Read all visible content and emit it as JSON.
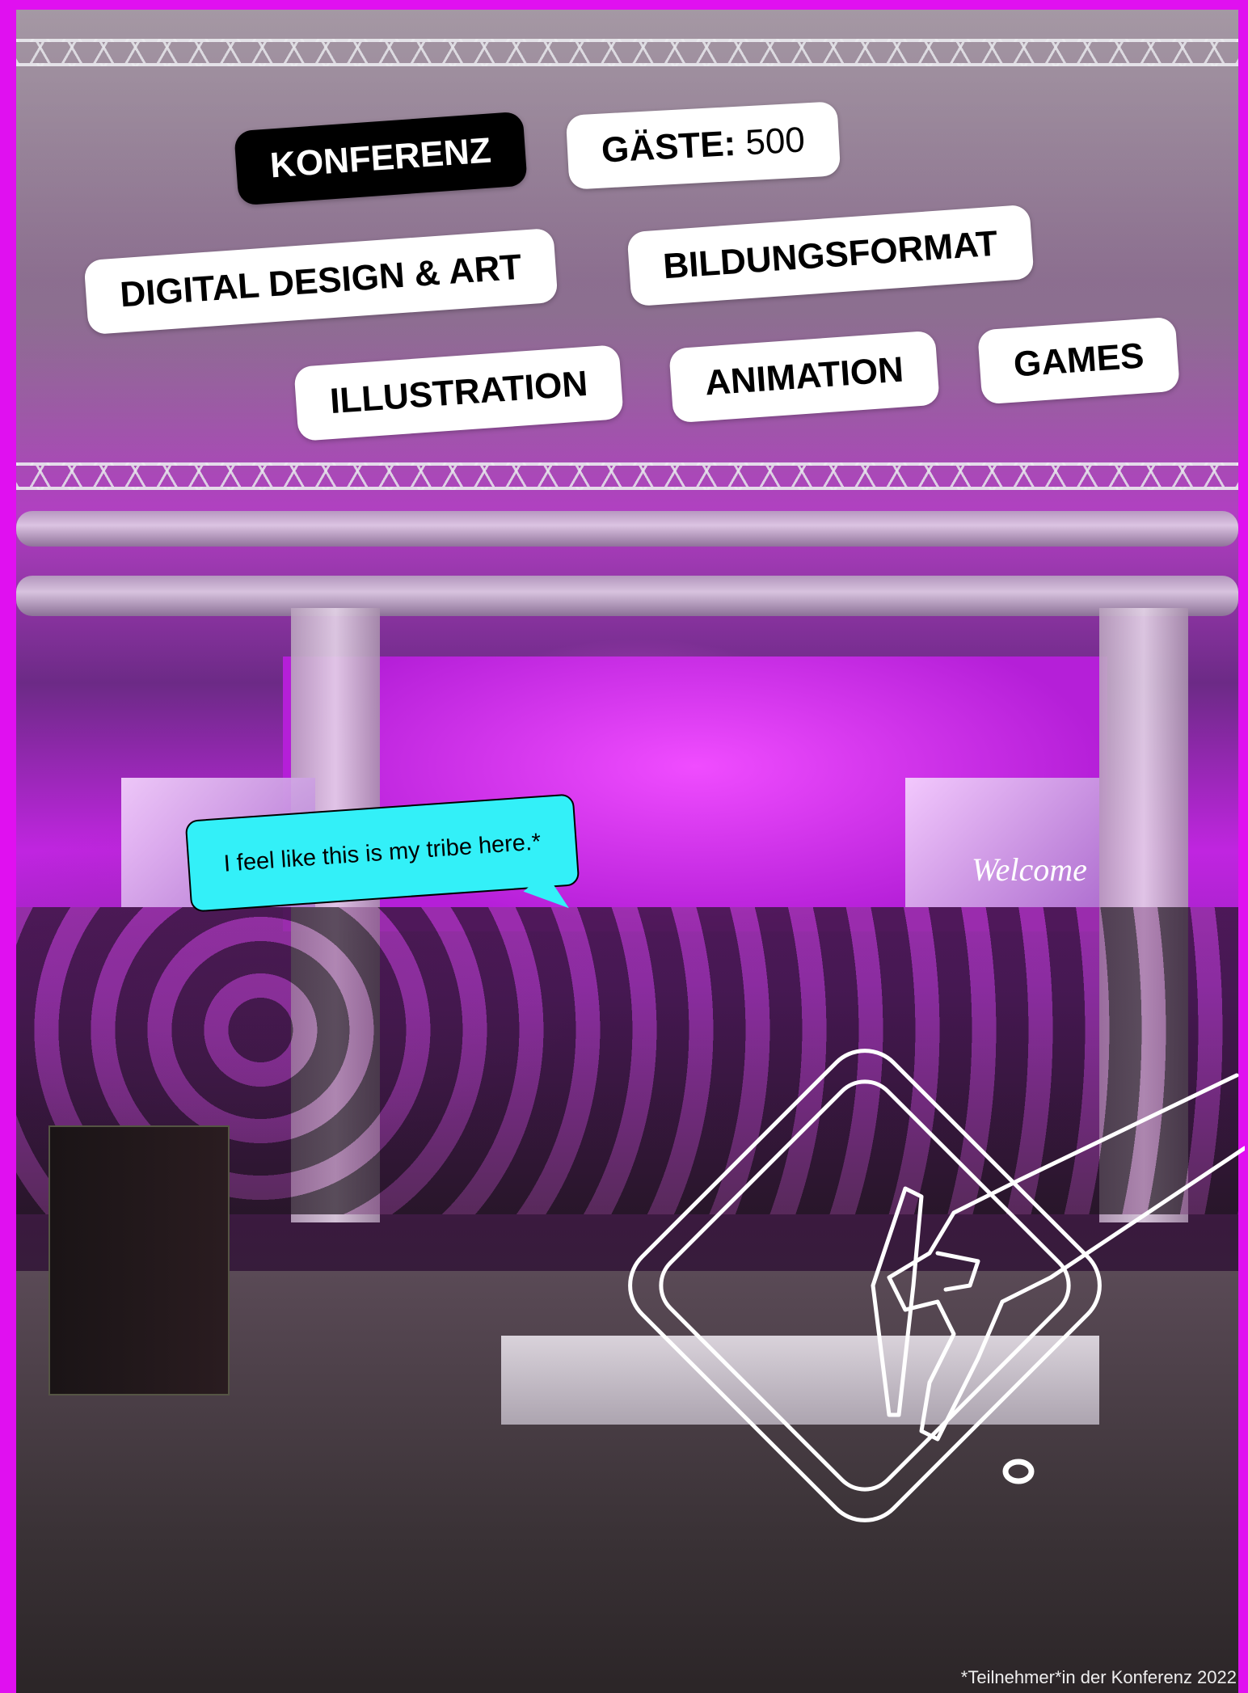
{
  "tags": {
    "konferenz": "KONFERENZ",
    "gaeste_label": "GÄSTE:",
    "gaeste_value": "500",
    "digital_design": "DIGITAL DESIGN & ART",
    "bildungsformat": "BILDUNGSFORMAT",
    "illustration": "ILLUSTRATION",
    "animation": "ANIMATION",
    "games": "GAMES"
  },
  "quote": "I feel like this is my tribe here.*",
  "photo": {
    "screen_text": "Welcome"
  },
  "caption": "*Teilnehmer*in der Konferenz 2022",
  "colors": {
    "border": "#e010f0",
    "bubble": "#33f0f8",
    "tag_bg": "#ffffff",
    "tag_dark_bg": "#000000"
  },
  "icons": [
    "drawing-tablet-icon"
  ]
}
